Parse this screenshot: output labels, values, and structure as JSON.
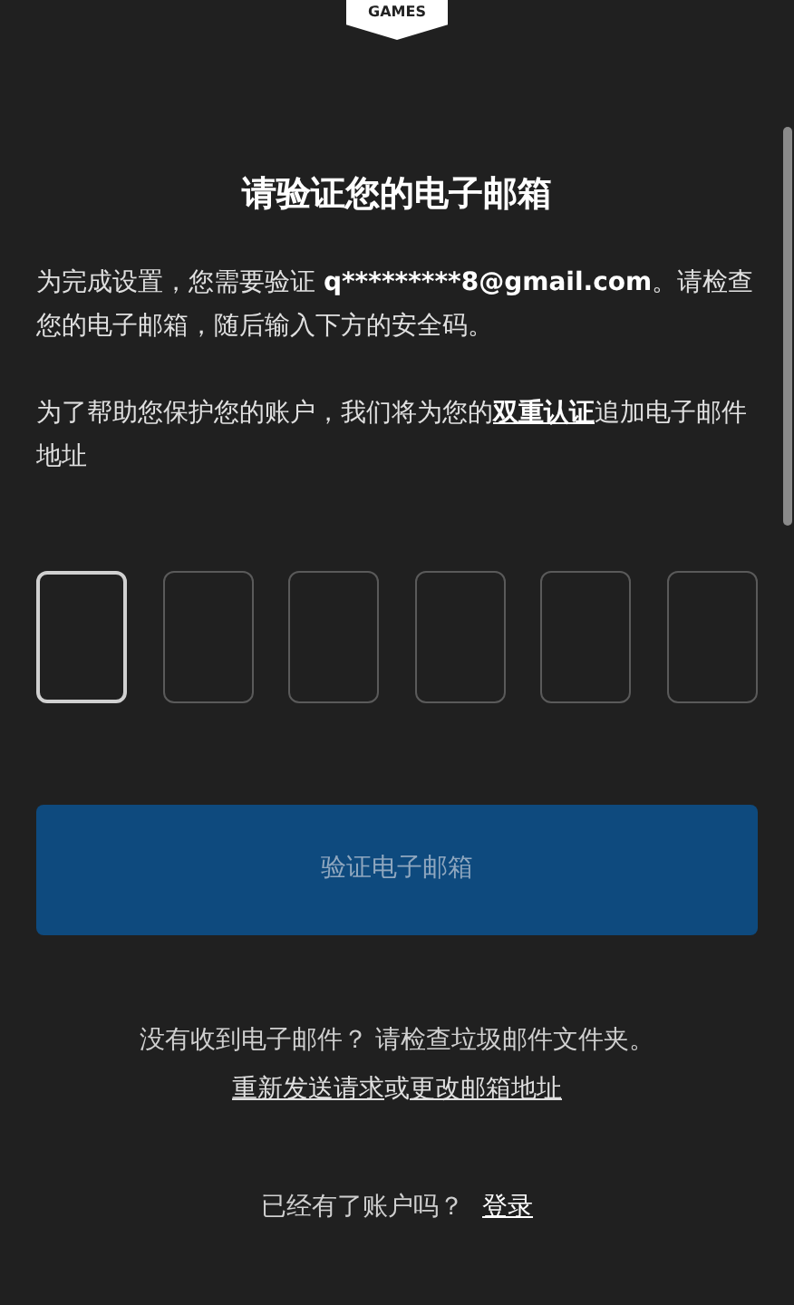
{
  "logo": {
    "text": "GAMES"
  },
  "title": "请验证您的电子邮箱",
  "intro": {
    "before": "为完成设置，您需要验证 ",
    "email": "q*********8@gmail.com",
    "after": "。请检查您的电子邮箱，随后输入下方的安全码。"
  },
  "security": {
    "before": "为了帮助您保护您的账户，我们将为您的",
    "link": "双重认证",
    "after": "追加电子邮件地址"
  },
  "code_boxes": [
    {
      "selected": true
    },
    {
      "selected": false
    },
    {
      "selected": false
    },
    {
      "selected": false
    },
    {
      "selected": false
    },
    {
      "selected": false
    }
  ],
  "verify_button": {
    "label": "验证电子邮箱",
    "disabled": true
  },
  "help": {
    "text": "没有收到电子邮件？ 请检查垃圾邮件文件夹。",
    "resend_link": "重新发送请求",
    "separator": "或",
    "change_link": "更改邮箱地址"
  },
  "signin": {
    "prompt": "已经有了账户吗？",
    "link": "登录"
  }
}
